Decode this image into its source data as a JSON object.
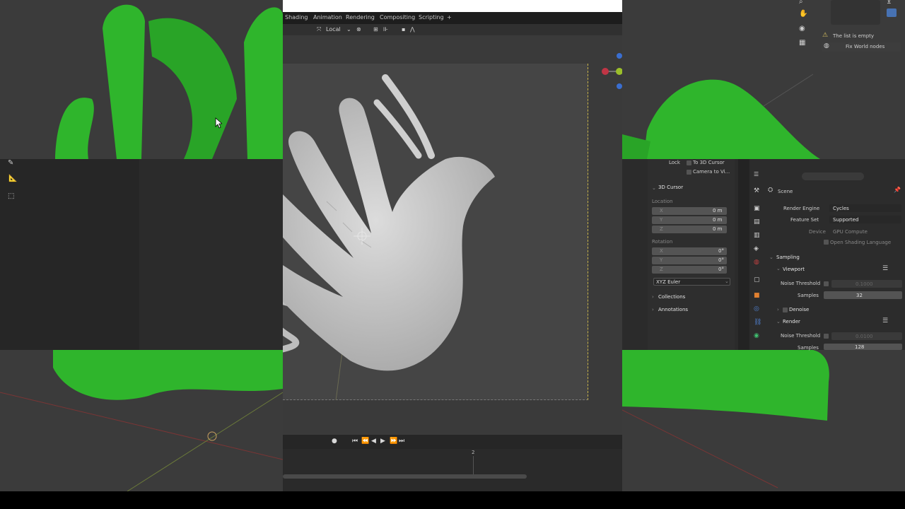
{
  "topbar": {
    "tabs": [
      "Shading",
      "Animation",
      "Rendering",
      "Compositing",
      "Scripting",
      "+"
    ]
  },
  "viewport_header": {
    "orientation": "Local"
  },
  "left_tools": [
    "annotate-icon",
    "measure-icon",
    "add-cube-icon"
  ],
  "top_right": {
    "warning_text": "The list is empty",
    "fix_button": "Fix World nodes"
  },
  "n_panel": {
    "lock_label": "Lock",
    "to_3d_cursor": "To 3D Cursor",
    "camera_to_view": "Camera to Vi...",
    "cursor_header": "3D Cursor",
    "location_label": "Location",
    "location": [
      {
        "axis": "X",
        "value": "0 m"
      },
      {
        "axis": "Y",
        "value": "0 m"
      },
      {
        "axis": "Z",
        "value": "0 m"
      }
    ],
    "rotation_label": "Rotation",
    "rotation": [
      {
        "axis": "X",
        "value": "0°"
      },
      {
        "axis": "Y",
        "value": "0°"
      },
      {
        "axis": "Z",
        "value": "0°"
      }
    ],
    "rotation_mode": "XYZ Euler",
    "collections": "Collections",
    "annotations": "Annotations"
  },
  "properties": {
    "scene_label": "Scene",
    "render_engine_label": "Render Engine",
    "render_engine": "Cycles",
    "feature_set_label": "Feature Set",
    "feature_set": "Supported",
    "device_label": "Device",
    "device": "GPU Compute",
    "osl_label": "Open Shading Language",
    "sampling": "Sampling",
    "viewport": "Viewport",
    "noise_threshold_label": "Noise Threshold",
    "viewport_noise": "0.1000",
    "samples_label": "Samples",
    "viewport_samples": "32",
    "denoise": "Denoise",
    "render": "Render",
    "render_noise": "0.0100",
    "render_samples": "128"
  },
  "timeline": {
    "frame_marker": "2"
  },
  "colors": {
    "accent_green": "#2fb52c",
    "hand": "#c9c9c9"
  }
}
